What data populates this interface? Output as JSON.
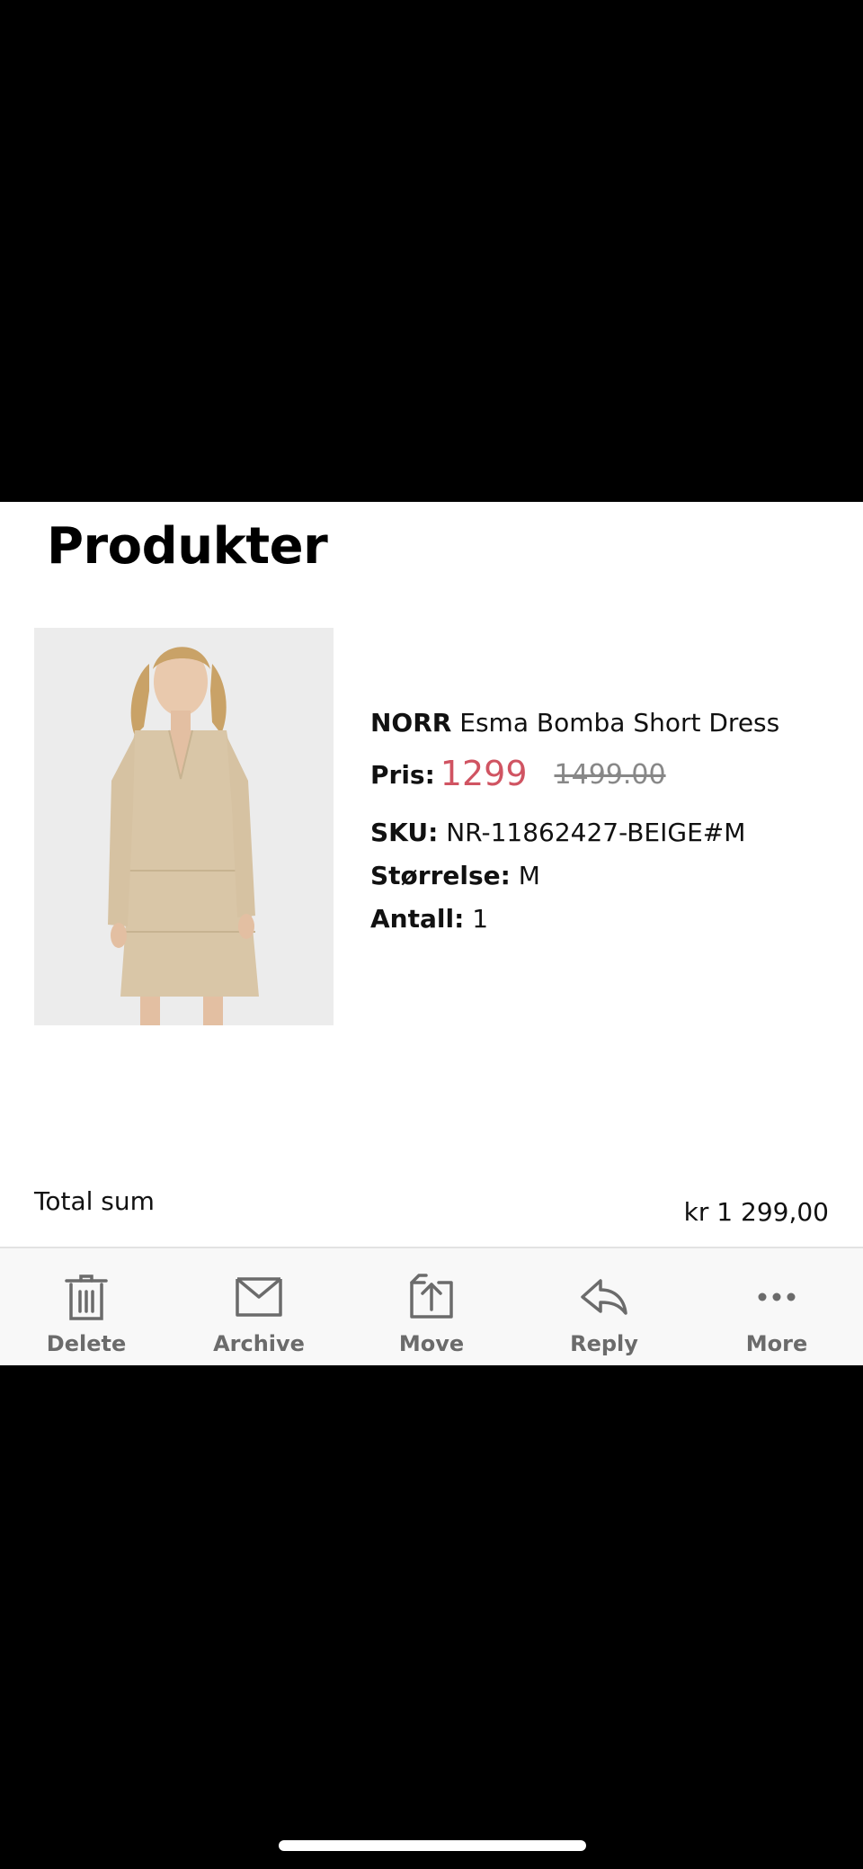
{
  "section_title": "Produkter",
  "product": {
    "brand": "NORR",
    "name": "Esma Bomba Short Dress",
    "price_label": "Pris:",
    "price_sale": "1299",
    "price_original": "1499.00",
    "sku_label": "SKU:",
    "sku_value": "NR-11862427-BEIGE#M",
    "size_label": "Størrelse:",
    "size_value": "M",
    "qty_label": "Antall:",
    "qty_value": "1"
  },
  "total": {
    "label": "Total sum",
    "value": "kr 1 299,00"
  },
  "toolbar": {
    "delete_label": "Delete",
    "archive_label": "Archive",
    "move_label": "Move",
    "reply_label": "Reply",
    "more_label": "More"
  },
  "colors": {
    "sale_price": "#d05462",
    "toolbar_icon": "#6b6b6b",
    "image_bg": "#ececec"
  },
  "icons": [
    "trash-icon",
    "archive-icon",
    "move-icon",
    "reply-icon",
    "more-icon"
  ]
}
